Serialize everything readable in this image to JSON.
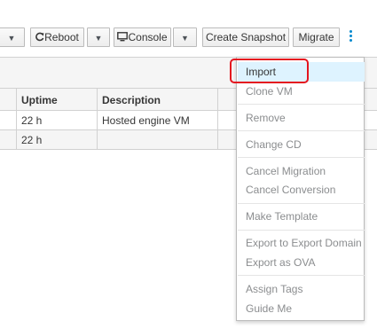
{
  "toolbar": {
    "reboot_label": "Reboot",
    "console_label": "Console",
    "create_snapshot_label": "Create Snapshot",
    "migrate_label": "Migrate"
  },
  "table": {
    "columns": [
      "Uptime",
      "Description"
    ],
    "rows": [
      {
        "uptime": "22 h",
        "description": "Hosted engine VM"
      },
      {
        "uptime": "22 h",
        "description": ""
      }
    ]
  },
  "menu": {
    "items": [
      {
        "label": "Import",
        "enabled": true
      },
      {
        "label": "Clone VM",
        "enabled": false
      },
      {
        "label": "Remove",
        "enabled": false
      },
      {
        "label": "Change CD",
        "enabled": false
      },
      {
        "label": "Cancel Migration",
        "enabled": false
      },
      {
        "label": "Cancel Conversion",
        "enabled": false
      },
      {
        "label": "Make Template",
        "enabled": false
      },
      {
        "label": "Export to Export Domain",
        "enabled": false
      },
      {
        "label": "Export as OVA",
        "enabled": false
      },
      {
        "label": "Assign Tags",
        "enabled": false
      },
      {
        "label": "Guide Me",
        "enabled": false
      }
    ]
  },
  "colors": {
    "highlight_border": "#e4151f",
    "active_item_bg": "#def3ff",
    "kebab": "#0088ce"
  }
}
